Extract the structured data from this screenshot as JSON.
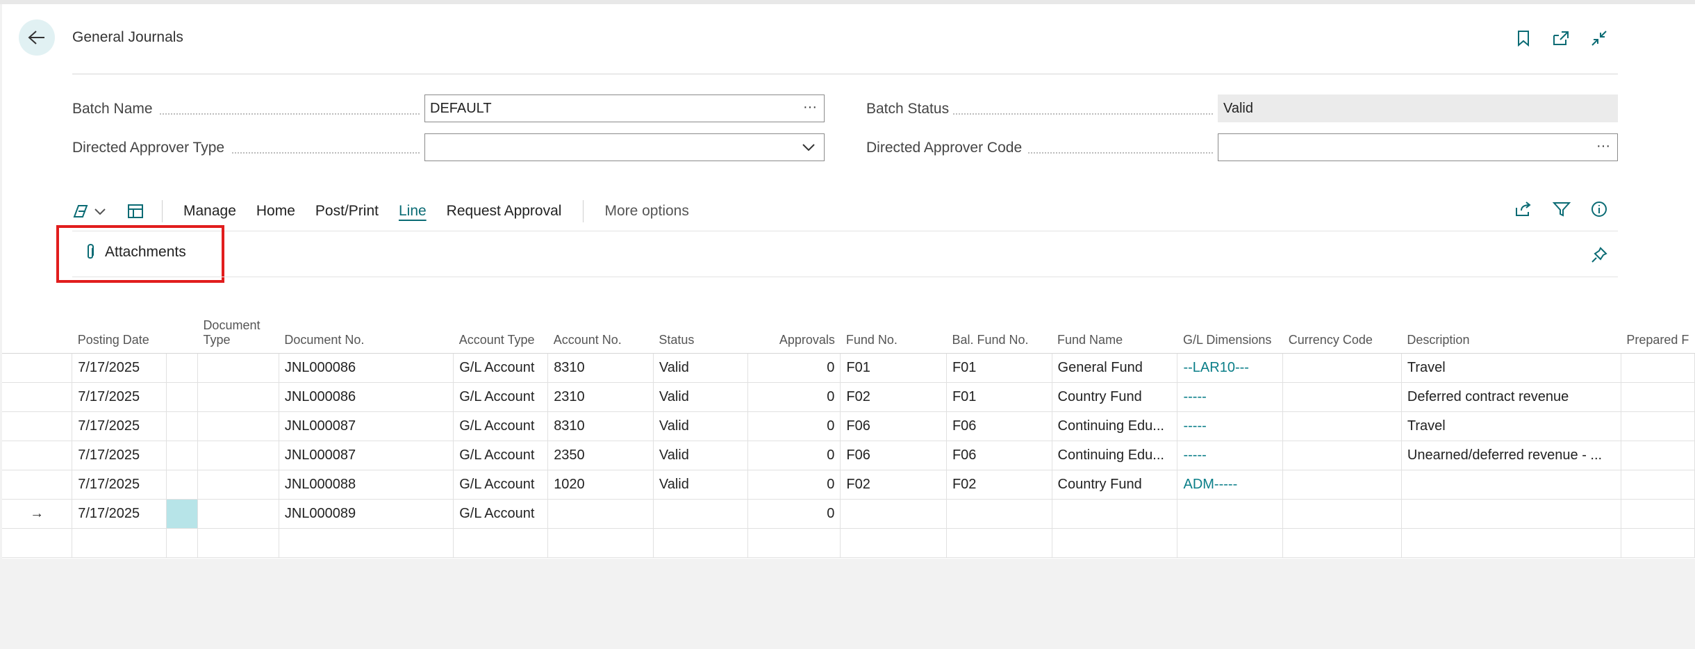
{
  "header": {
    "title": "General Journals"
  },
  "fields": {
    "batch_name_label": "Batch Name",
    "batch_name_value": "DEFAULT",
    "batch_status_label": "Batch Status",
    "batch_status_value": "Valid",
    "directed_approver_type_label": "Directed Approver Type",
    "directed_approver_type_value": "",
    "directed_approver_code_label": "Directed Approver Code",
    "directed_approver_code_value": "",
    "lookup_glyph": "···"
  },
  "actions": {
    "manage": "Manage",
    "home": "Home",
    "post_print": "Post/Print",
    "line": "Line",
    "request_approval": "Request Approval",
    "more_options": "More options",
    "active": "Line"
  },
  "subactions": {
    "attachments": "Attachments"
  },
  "columns": [
    "Posting Date",
    "Document Type",
    "Document No.",
    "Account Type",
    "Account No.",
    "Status",
    "Approvals",
    "Fund No.",
    "Bal. Fund No.",
    "Fund Name",
    "G/L Dimensions",
    "Currency Code",
    "Description",
    "Prepared F"
  ],
  "rows": [
    {
      "ind": "",
      "date": "7/17/2025",
      "doc_type": "",
      "doc_no": "JNL000086",
      "acc_type": "G/L Account",
      "acc_no": "8310",
      "status": "Valid",
      "approvals": "0",
      "fund": "F01",
      "bal_fund": "F01",
      "fund_name": "General Fund",
      "gl_dim": "--LAR10---",
      "currency": "",
      "description": "Travel",
      "prepared": ""
    },
    {
      "ind": "",
      "date": "7/17/2025",
      "doc_type": "",
      "doc_no": "JNL000086",
      "acc_type": "G/L Account",
      "acc_no": "2310",
      "status": "Valid",
      "approvals": "0",
      "fund": "F02",
      "bal_fund": "F01",
      "fund_name": "Country Fund",
      "gl_dim": "-----",
      "currency": "",
      "description": "Deferred contract revenue",
      "prepared": ""
    },
    {
      "ind": "",
      "date": "7/17/2025",
      "doc_type": "",
      "doc_no": "JNL000087",
      "acc_type": "G/L Account",
      "acc_no": "8310",
      "status": "Valid",
      "approvals": "0",
      "fund": "F06",
      "bal_fund": "F06",
      "fund_name": "Continuing Edu...",
      "gl_dim": "-----",
      "currency": "",
      "description": "Travel",
      "prepared": ""
    },
    {
      "ind": "",
      "date": "7/17/2025",
      "doc_type": "",
      "doc_no": "JNL000087",
      "acc_type": "G/L Account",
      "acc_no": "2350",
      "status": "Valid",
      "approvals": "0",
      "fund": "F06",
      "bal_fund": "F06",
      "fund_name": "Continuing Edu...",
      "gl_dim": "-----",
      "currency": "",
      "description": "Unearned/deferred revenue - ...",
      "prepared": ""
    },
    {
      "ind": "",
      "date": "7/17/2025",
      "doc_type": "",
      "doc_no": "JNL000088",
      "acc_type": "G/L Account",
      "acc_no": "1020",
      "status": "Valid",
      "approvals": "0",
      "fund": "F02",
      "bal_fund": "F02",
      "fund_name": "Country Fund",
      "gl_dim": "ADM-----",
      "currency": "",
      "description": "",
      "prepared": ""
    },
    {
      "ind": "→",
      "date": "7/17/2025",
      "doc_type": "",
      "doc_no": "JNL000089",
      "acc_type": "G/L Account",
      "acc_no": "",
      "status": "",
      "approvals": "0",
      "fund": "",
      "bal_fund": "",
      "fund_name": "",
      "gl_dim": "",
      "currency": "",
      "description": "",
      "prepared": ""
    },
    {
      "ind": "",
      "date": "",
      "doc_type": "",
      "doc_no": "",
      "acc_type": "",
      "acc_no": "",
      "status": "",
      "approvals": "",
      "fund": "",
      "bal_fund": "",
      "fund_name": "",
      "gl_dim": "",
      "currency": "",
      "description": "",
      "prepared": ""
    }
  ],
  "colors": {
    "accent": "#0a7e88",
    "highlight": "#e11d1d",
    "selected_cell": "#b7e4e8"
  },
  "icons": [
    "back-arrow-icon",
    "bookmark-icon",
    "open-new-window-icon",
    "collapse-icon",
    "copilot-icon",
    "chevron-down-icon",
    "page-layout-icon",
    "share-icon",
    "filter-icon",
    "info-icon",
    "paperclip-icon",
    "pin-icon"
  ]
}
